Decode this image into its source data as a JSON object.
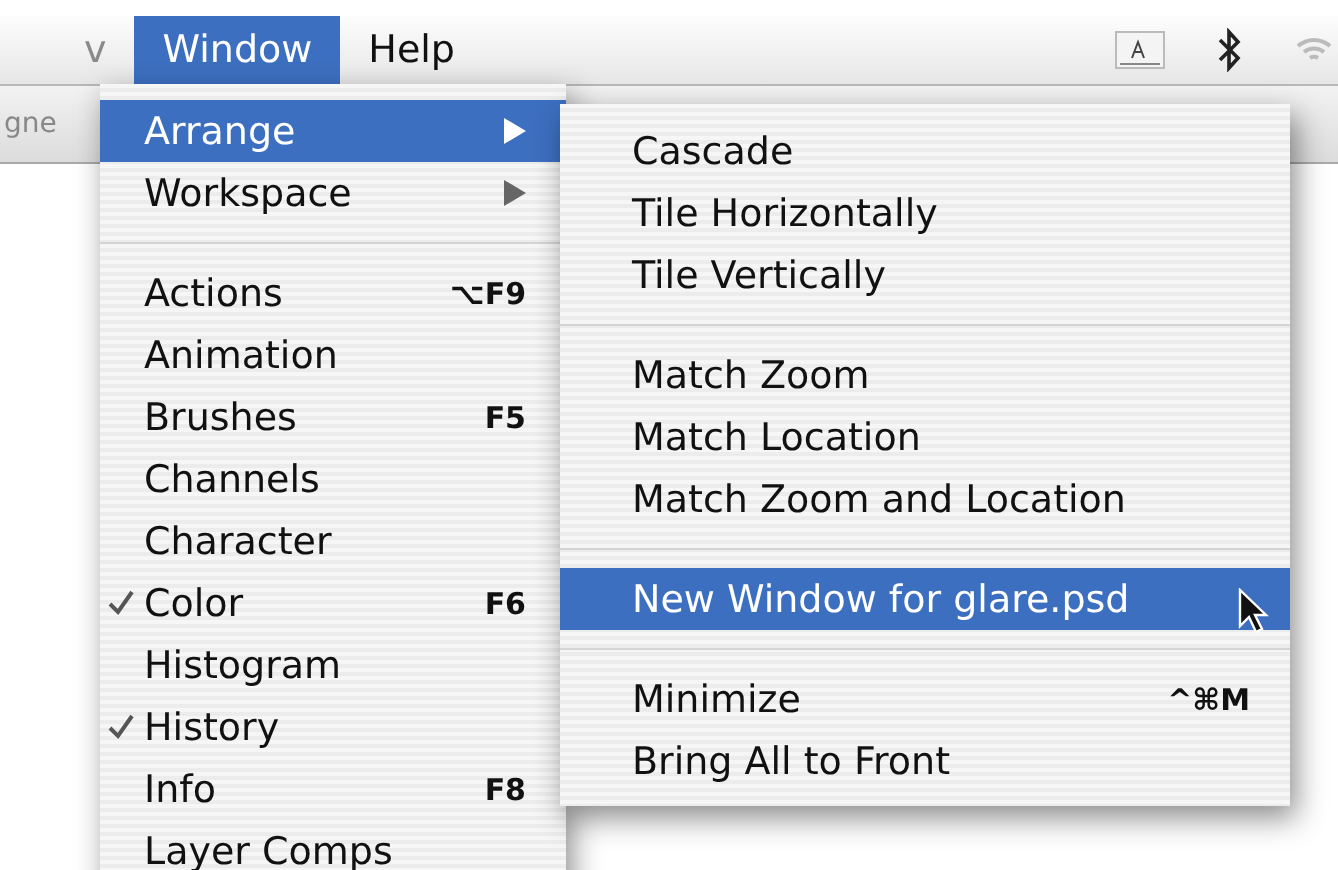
{
  "menu_bar": {
    "menus": [
      {
        "label": "v",
        "selected": false
      },
      {
        "label": "Window",
        "selected": true
      },
      {
        "label": "Help",
        "selected": false
      }
    ]
  },
  "background": {
    "text": "gne"
  },
  "window_menu": {
    "items": [
      {
        "kind": "item",
        "label": "Arrange",
        "submenu": true,
        "selected": true,
        "checked": false
      },
      {
        "kind": "item",
        "label": "Workspace",
        "submenu": true,
        "selected": false,
        "checked": false
      },
      {
        "kind": "separator"
      },
      {
        "kind": "item",
        "label": "Actions",
        "shortcut": "⌥F9",
        "submenu": false,
        "selected": false,
        "checked": false
      },
      {
        "kind": "item",
        "label": "Animation",
        "submenu": false,
        "selected": false,
        "checked": false
      },
      {
        "kind": "item",
        "label": "Brushes",
        "shortcut": "F5",
        "submenu": false,
        "selected": false,
        "checked": false
      },
      {
        "kind": "item",
        "label": "Channels",
        "submenu": false,
        "selected": false,
        "checked": false
      },
      {
        "kind": "item",
        "label": "Character",
        "submenu": false,
        "selected": false,
        "checked": false
      },
      {
        "kind": "item",
        "label": "Color",
        "shortcut": "F6",
        "submenu": false,
        "selected": false,
        "checked": true
      },
      {
        "kind": "item",
        "label": "Histogram",
        "submenu": false,
        "selected": false,
        "checked": false
      },
      {
        "kind": "item",
        "label": "History",
        "submenu": false,
        "selected": false,
        "checked": true
      },
      {
        "kind": "item",
        "label": "Info",
        "shortcut": "F8",
        "submenu": false,
        "selected": false,
        "checked": false
      },
      {
        "kind": "item",
        "label": "Layer Comps",
        "submenu": false,
        "selected": false,
        "checked": false
      }
    ]
  },
  "arrange_submenu": {
    "items": [
      {
        "kind": "item",
        "label": "Cascade",
        "selected": false
      },
      {
        "kind": "item",
        "label": "Tile Horizontally",
        "selected": false
      },
      {
        "kind": "item",
        "label": "Tile Vertically",
        "selected": false
      },
      {
        "kind": "separator"
      },
      {
        "kind": "item",
        "label": "Match Zoom",
        "selected": false
      },
      {
        "kind": "item",
        "label": "Match Location",
        "selected": false
      },
      {
        "kind": "item",
        "label": "Match Zoom and Location",
        "selected": false
      },
      {
        "kind": "separator"
      },
      {
        "kind": "item",
        "label": "New Window for glare.psd",
        "selected": true
      },
      {
        "kind": "separator"
      },
      {
        "kind": "item",
        "label": "Minimize",
        "shortcut": "^⌘M",
        "selected": false
      },
      {
        "kind": "item",
        "label": "Bring All to Front",
        "selected": false
      }
    ]
  }
}
